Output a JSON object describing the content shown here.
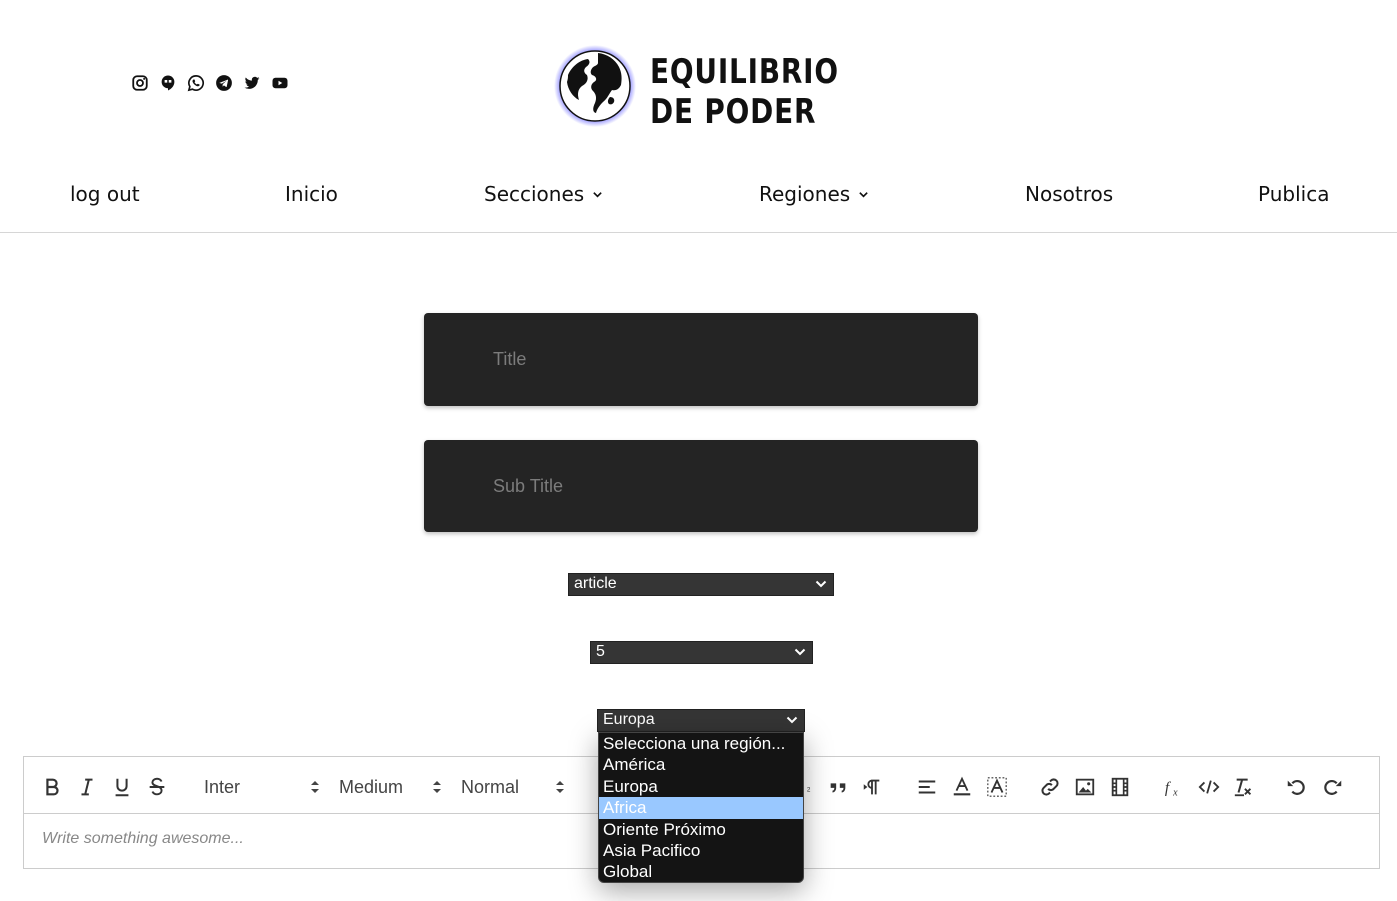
{
  "header": {
    "social_icons": [
      "instagram-icon",
      "hangouts-icon",
      "whatsapp-icon",
      "telegram-icon",
      "twitter-icon",
      "youtube-icon"
    ],
    "logo": {
      "line1": "EQUILIBRIO",
      "line2": "DE PODER"
    }
  },
  "nav": {
    "items": [
      {
        "label": "log out"
      },
      {
        "label": "Inicio"
      },
      {
        "label": "Secciones",
        "dropdown": true
      },
      {
        "label": "Regiones",
        "dropdown": true
      },
      {
        "label": "Nosotros"
      },
      {
        "label": "Publica"
      }
    ]
  },
  "form": {
    "title_placeholder": "Title",
    "subtitle_placeholder": "Sub Title",
    "type_select": {
      "value": "article"
    },
    "number_select": {
      "value": "5"
    },
    "region_select": {
      "value": "Europa",
      "options": [
        "Selecciona una región...",
        "América",
        "Europa",
        "Africa",
        "Oriente Próximo",
        "Asia Pacifico",
        "Global"
      ],
      "highlighted": "Africa"
    }
  },
  "editor": {
    "font": "Inter",
    "weight": "Medium",
    "size": "Normal",
    "placeholder": "Write something awesome..."
  },
  "colors": {
    "field_bg": "#242424",
    "select_bg": "#353535",
    "highlight": "#99c8ff",
    "globe_glow": "#6f6dff"
  }
}
